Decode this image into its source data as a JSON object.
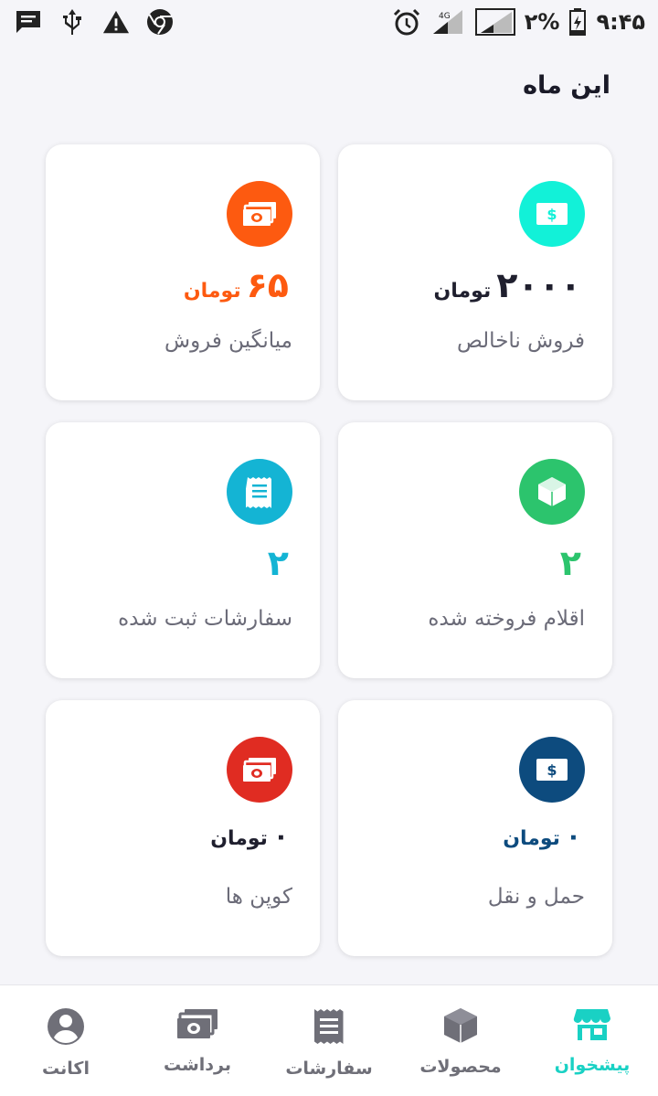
{
  "status_bar": {
    "time": "۹:۴۵",
    "battery_percent": "۲%",
    "network_label": "4G",
    "left_icons": [
      "message-icon",
      "usb-icon",
      "warning-icon",
      "chrome-icon"
    ],
    "right_icons": [
      "alarm-icon",
      "signal-icon",
      "signal-icon-2",
      "battery-icon"
    ]
  },
  "page": {
    "section_title": "این ماه"
  },
  "cards": [
    {
      "id": "net-sales",
      "icon": "cash-icon",
      "color": "#12f1d8",
      "value": "۲۰۰۰",
      "unit": "تومان",
      "value_color": "#1f1f2e",
      "label": "فروش ناخالص"
    },
    {
      "id": "avg-sales",
      "icon": "money-stack-icon",
      "color": "#fd5a10",
      "value": "۶۵",
      "unit": "تومان",
      "value_color": "#fd5a10",
      "label": "میانگین فروش"
    },
    {
      "id": "items-sold",
      "icon": "box-icon",
      "color": "#2cc46d",
      "value": "۲",
      "unit": "",
      "value_color": "#2cc46d",
      "label": "اقلام فروخته شده"
    },
    {
      "id": "orders",
      "icon": "receipt-icon",
      "color": "#14b4d4",
      "value": "۲",
      "unit": "",
      "value_color": "#14b4d4",
      "label": "سفارشات ثبت شده"
    },
    {
      "id": "shipping",
      "icon": "cash-icon",
      "color": "#0d4b7e",
      "value": "۰",
      "unit": "تومان",
      "value_color": "#0d4b7e",
      "label": "حمل و نقل"
    },
    {
      "id": "coupons",
      "icon": "money-stack-icon",
      "color": "#e02c22",
      "value": "۰",
      "unit": "تومان",
      "value_color": "#1f1f2e",
      "label": "کوپن ها"
    }
  ],
  "bottom_nav": [
    {
      "id": "dashboard",
      "label": "پیشخوان",
      "icon": "store-icon",
      "active": true
    },
    {
      "id": "products",
      "label": "محصولات",
      "icon": "box-icon",
      "active": false
    },
    {
      "id": "orders",
      "label": "سفارشات",
      "icon": "receipt-icon",
      "active": false
    },
    {
      "id": "withdraw",
      "label": "برداشت",
      "icon": "money-stack-icon",
      "active": false
    },
    {
      "id": "account",
      "label": "اکانت",
      "icon": "account-icon",
      "active": false
    }
  ]
}
